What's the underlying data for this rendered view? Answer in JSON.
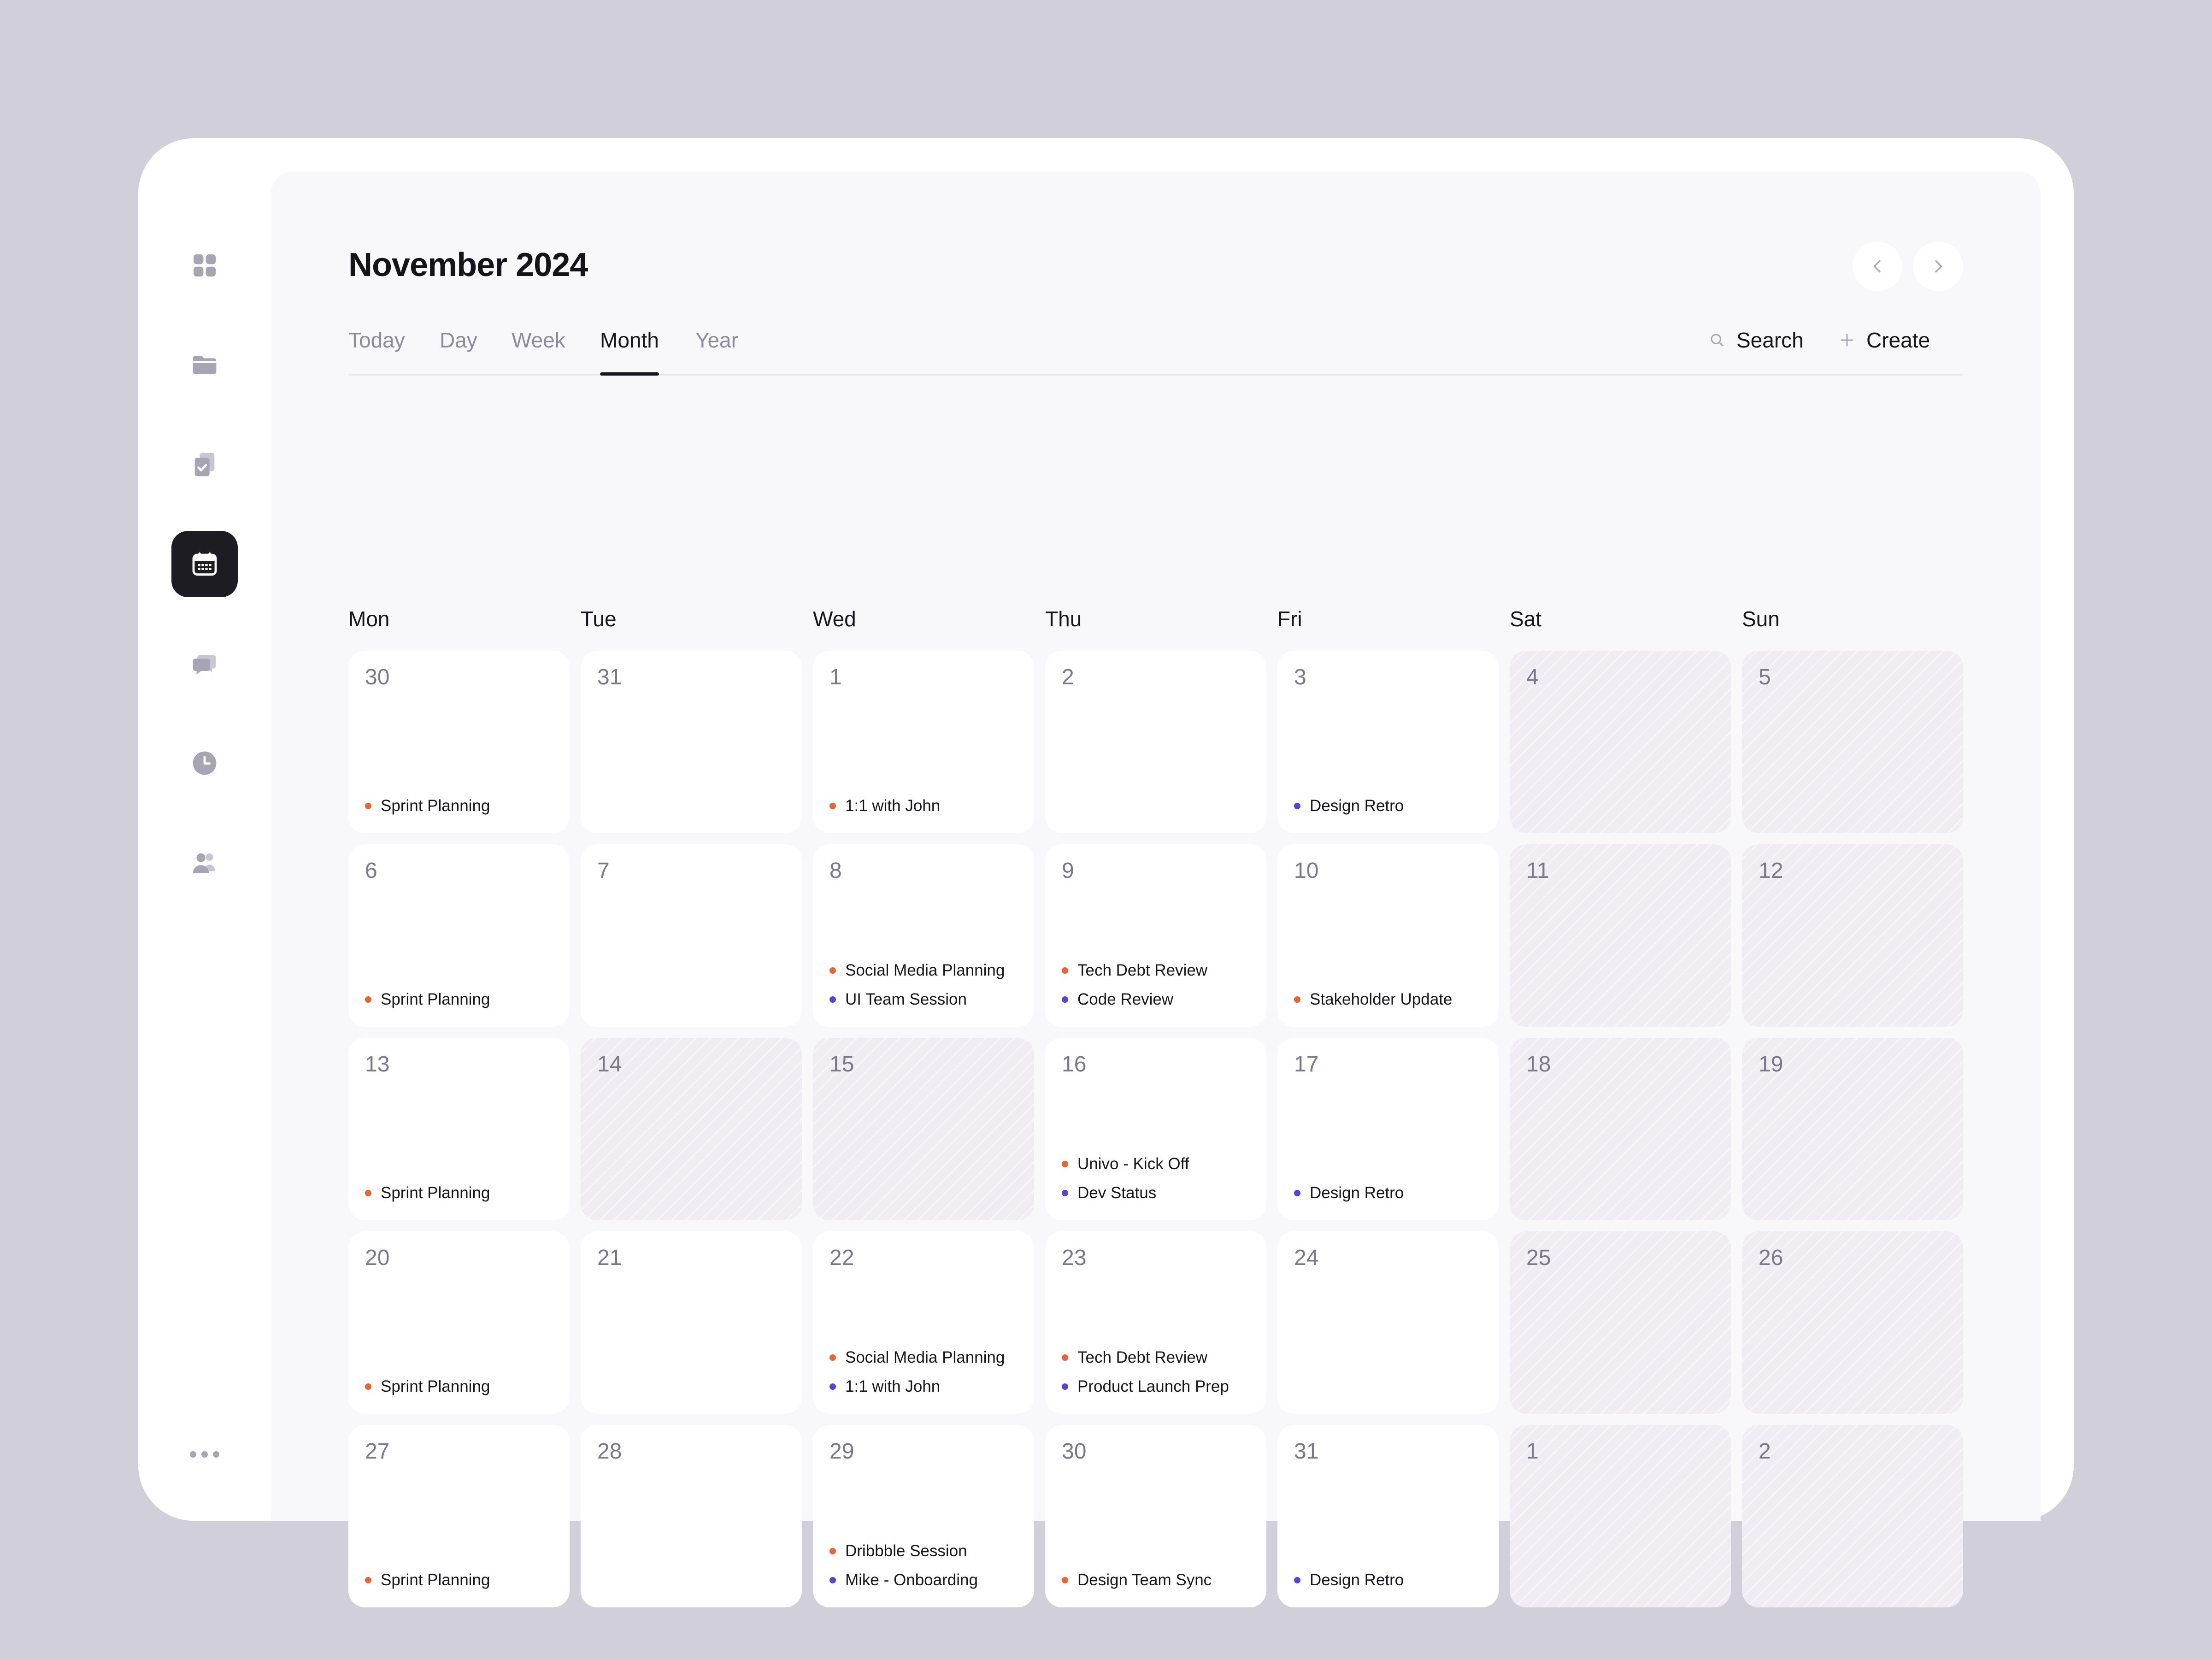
{
  "title": "November 2024",
  "colors": {
    "orange": "#f0622d",
    "purple": "#5b3fe0"
  },
  "sidebar": {
    "items": [
      {
        "icon": "dashboard-icon",
        "active": false
      },
      {
        "icon": "folder-icon",
        "active": false
      },
      {
        "icon": "clipboard-check-icon",
        "active": false
      },
      {
        "icon": "calendar-icon",
        "active": true
      },
      {
        "icon": "chat-icon",
        "active": false
      },
      {
        "icon": "clock-icon",
        "active": false
      },
      {
        "icon": "users-icon",
        "active": false
      }
    ],
    "more_icon": "more-dots-icon"
  },
  "nav": {
    "prev_icon": "chevron-left-icon",
    "next_icon": "chevron-right-icon"
  },
  "tabs": [
    {
      "label": "Today",
      "active": false
    },
    {
      "label": "Day",
      "active": false
    },
    {
      "label": "Week",
      "active": false
    },
    {
      "label": "Month",
      "active": true
    },
    {
      "label": "Year",
      "active": false
    }
  ],
  "toolbar": {
    "search_label": "Search",
    "create_label": "Create"
  },
  "weekdays": [
    "Mon",
    "Tue",
    "Wed",
    "Thu",
    "Fri",
    "Sat",
    "Sun"
  ],
  "weeks": [
    [
      {
        "day": "30",
        "off": false,
        "events": [
          {
            "label": "Sprint Planning",
            "color": "orange"
          }
        ]
      },
      {
        "day": "31",
        "off": false,
        "events": []
      },
      {
        "day": "1",
        "off": false,
        "events": [
          {
            "label": "1:1 with John",
            "color": "orange"
          }
        ]
      },
      {
        "day": "2",
        "off": false,
        "events": []
      },
      {
        "day": "3",
        "off": false,
        "events": [
          {
            "label": "Design Retro",
            "color": "purple"
          }
        ]
      },
      {
        "day": "4",
        "off": true,
        "events": []
      },
      {
        "day": "5",
        "off": true,
        "events": []
      }
    ],
    [
      {
        "day": "6",
        "off": false,
        "events": [
          {
            "label": "Sprint Planning",
            "color": "orange"
          }
        ]
      },
      {
        "day": "7",
        "off": false,
        "events": []
      },
      {
        "day": "8",
        "off": false,
        "events": [
          {
            "label": "Social Media Planning",
            "color": "orange"
          },
          {
            "label": "UI Team Session",
            "color": "purple"
          }
        ]
      },
      {
        "day": "9",
        "off": false,
        "events": [
          {
            "label": "Tech Debt Review",
            "color": "orange"
          },
          {
            "label": "Code Review",
            "color": "purple"
          }
        ]
      },
      {
        "day": "10",
        "off": false,
        "events": [
          {
            "label": "Stakeholder Update",
            "color": "orange"
          }
        ]
      },
      {
        "day": "11",
        "off": true,
        "events": []
      },
      {
        "day": "12",
        "off": true,
        "events": []
      }
    ],
    [
      {
        "day": "13",
        "off": false,
        "events": [
          {
            "label": "Sprint Planning",
            "color": "orange"
          }
        ]
      },
      {
        "day": "14",
        "off": true,
        "events": []
      },
      {
        "day": "15",
        "off": true,
        "events": []
      },
      {
        "day": "16",
        "off": false,
        "events": [
          {
            "label": "Univo - Kick Off",
            "color": "orange"
          },
          {
            "label": "Dev Status",
            "color": "purple"
          }
        ]
      },
      {
        "day": "17",
        "off": false,
        "events": [
          {
            "label": "Design Retro",
            "color": "purple"
          }
        ]
      },
      {
        "day": "18",
        "off": true,
        "events": []
      },
      {
        "day": "19",
        "off": true,
        "events": []
      }
    ],
    [
      {
        "day": "20",
        "off": false,
        "events": [
          {
            "label": "Sprint Planning",
            "color": "orange"
          }
        ]
      },
      {
        "day": "21",
        "off": false,
        "events": []
      },
      {
        "day": "22",
        "off": false,
        "events": [
          {
            "label": "Social Media Planning",
            "color": "orange"
          },
          {
            "label": "1:1 with John",
            "color": "purple"
          }
        ]
      },
      {
        "day": "23",
        "off": false,
        "events": [
          {
            "label": "Tech Debt Review",
            "color": "orange"
          },
          {
            "label": "Product Launch Prep",
            "color": "purple"
          }
        ]
      },
      {
        "day": "24",
        "off": false,
        "events": []
      },
      {
        "day": "25",
        "off": true,
        "events": []
      },
      {
        "day": "26",
        "off": true,
        "events": []
      }
    ],
    [
      {
        "day": "27",
        "off": false,
        "events": [
          {
            "label": "Sprint Planning",
            "color": "orange"
          }
        ]
      },
      {
        "day": "28",
        "off": false,
        "events": []
      },
      {
        "day": "29",
        "off": false,
        "events": [
          {
            "label": "Dribbble Session",
            "color": "orange"
          },
          {
            "label": "Mike - Onboarding",
            "color": "purple"
          }
        ]
      },
      {
        "day": "30",
        "off": false,
        "events": [
          {
            "label": "Design Team Sync",
            "color": "orange"
          }
        ]
      },
      {
        "day": "31",
        "off": false,
        "events": [
          {
            "label": "Design Retro",
            "color": "purple"
          }
        ]
      },
      {
        "day": "1",
        "off": true,
        "events": []
      },
      {
        "day": "2",
        "off": true,
        "events": []
      }
    ]
  ]
}
